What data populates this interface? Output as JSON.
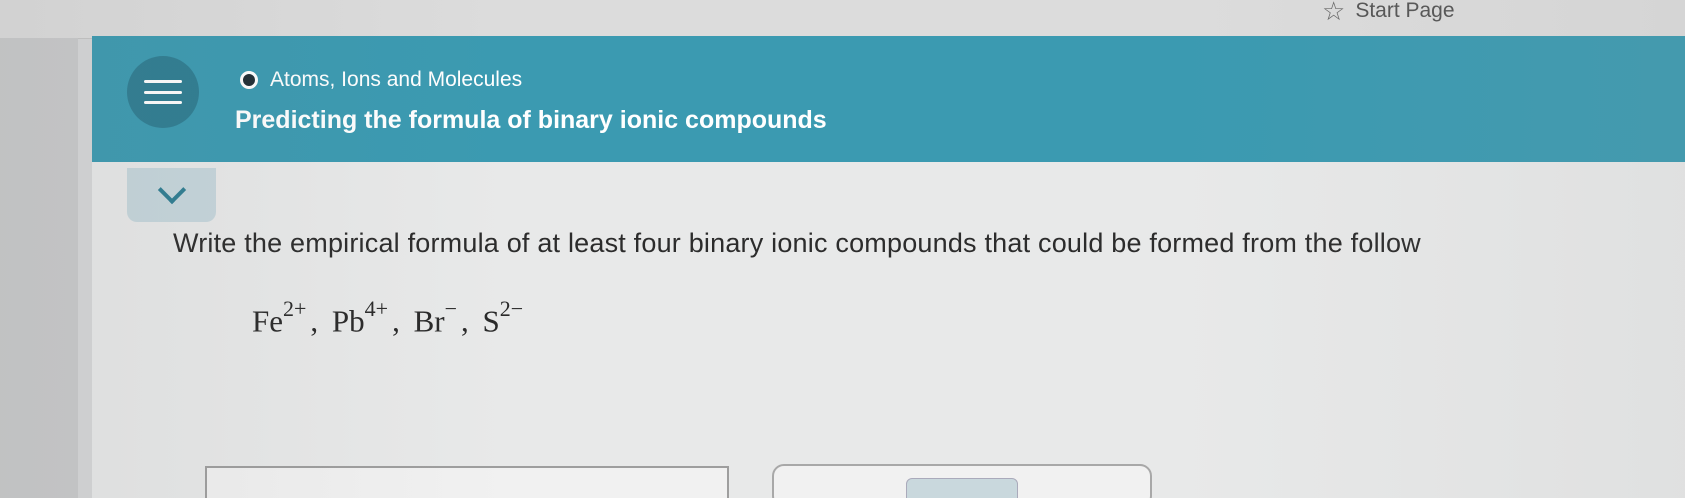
{
  "topbar": {
    "start_page_label": "Start Page",
    "star_icon": "☆"
  },
  "header": {
    "topic": "Atoms, Ions and Molecules",
    "title": "Predicting the formula of binary ionic compounds",
    "menu_icon": "hamburger-menu-icon",
    "collapse_icon": "chevron-down-icon"
  },
  "question": {
    "prompt": "Write the empirical formula of at least four binary ionic compounds that could be formed from the follow",
    "ions": [
      {
        "symbol": "Fe",
        "charge": "2+"
      },
      {
        "symbol": "Pb",
        "charge": "4+"
      },
      {
        "symbol": "Br",
        "charge": "−"
      },
      {
        "symbol": "S",
        "charge": "2−"
      }
    ],
    "separator": ","
  },
  "colors": {
    "header_bg": "#3b9ab1",
    "menu_button_bg": "#2e7d92",
    "content_bg": "#e8e9e9",
    "text": "#2c2c2c"
  }
}
